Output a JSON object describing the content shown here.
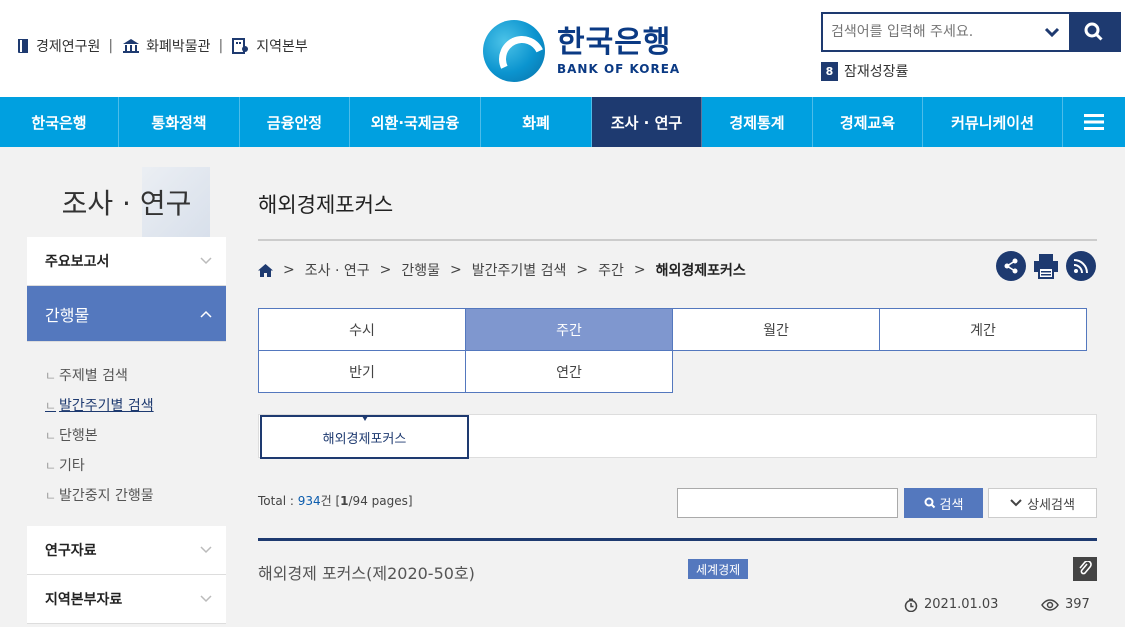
{
  "header": {
    "util_links": [
      "경제연구원",
      "화폐박물관",
      "지역본부"
    ],
    "logo_ko": "한국은행",
    "logo_en": "BANK OF KOREA",
    "search_placeholder": "검색어를 입력해 주세요.",
    "rank_number": "8",
    "rank_text": "잠재성장률"
  },
  "gnb": {
    "items": [
      "한국은행",
      "통화정책",
      "금융안정",
      "외환·국제금융",
      "화폐",
      "조사 · 연구",
      "경제통계",
      "경제교육",
      "커뮤니케이션"
    ],
    "active": "조사 · 연구"
  },
  "sidebar": {
    "title": "조사 · 연구",
    "menu": [
      "주요보고서",
      "간행물",
      "연구자료",
      "지역본부자료"
    ],
    "subitems": [
      "주제별 검색",
      "발간주기별 검색",
      "단행본",
      "기타",
      "발간중지 간행물"
    ]
  },
  "main": {
    "page_title": "해외경제포커스",
    "breadcrumb": [
      "조사 · 연구",
      "간행물",
      "발간주기별 검색",
      "주간",
      "해외경제포커스"
    ],
    "tabs": [
      "수시",
      "주간",
      "월간",
      "계간",
      "반기",
      "연간"
    ],
    "active_tab": "주간",
    "subtab": "해외경제포커스",
    "total_label": "Total : ",
    "total_count": "934",
    "total_unit": "건",
    "pages_prefix": " [",
    "page_current": "1",
    "pages_suffix": "/94 pages]",
    "search_button": "검색",
    "detail_button": "상세검색",
    "items": [
      {
        "title": "해외경제 포커스(제2020-50호)",
        "badge": "세계경제",
        "date": "2021.01.03",
        "views": "397"
      }
    ]
  },
  "colors": {
    "navy": "#1e3a70",
    "sky": "#00a0e0",
    "accent": "#5478be"
  }
}
